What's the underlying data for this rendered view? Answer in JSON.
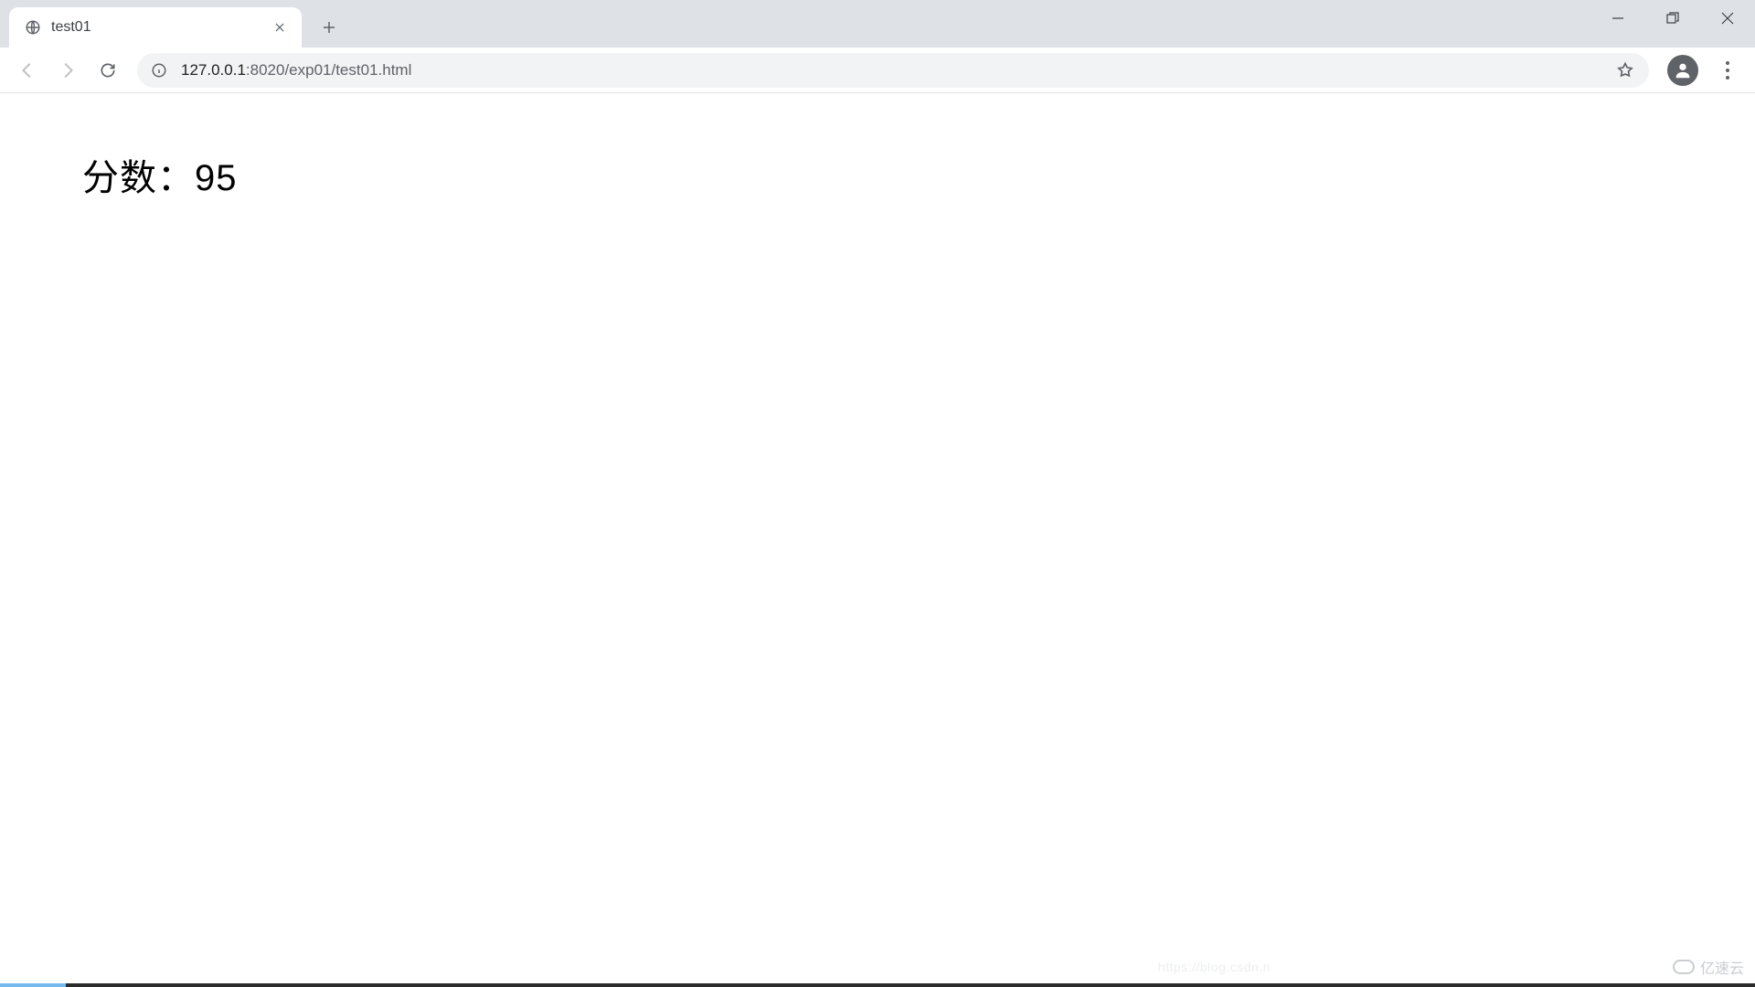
{
  "tab": {
    "title": "test01"
  },
  "url": {
    "host": "127.0.0.1",
    "port_path": ":8020/exp01/test01.html"
  },
  "page": {
    "score_label": "分数：",
    "score_value": "95"
  },
  "watermark": {
    "right": "亿速云",
    "center": "https://blog.csdn.n"
  }
}
